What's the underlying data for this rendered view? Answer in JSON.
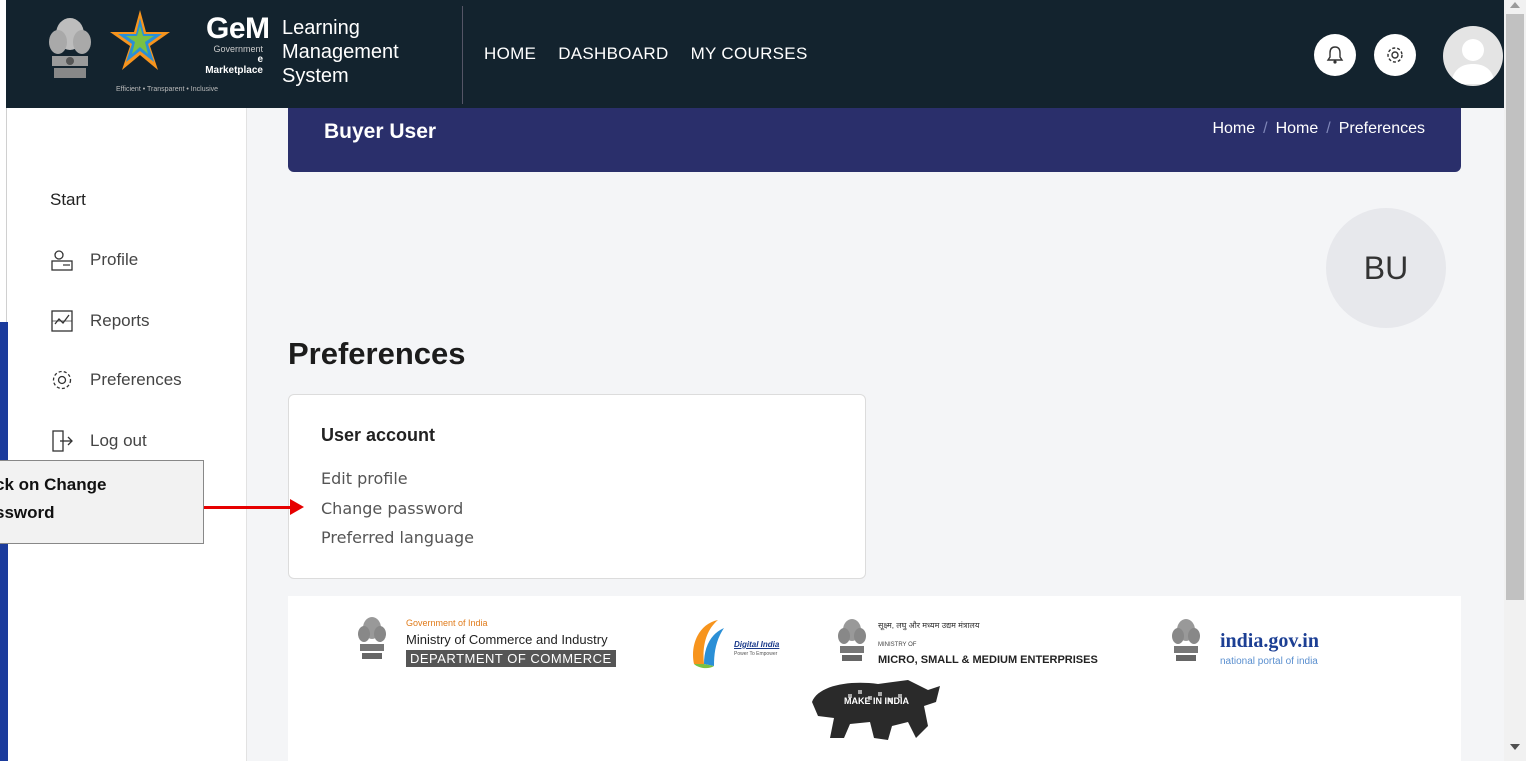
{
  "brand": {
    "gem_word": "GeM",
    "gem_sub1": "Government",
    "gem_sub2": "e Marketplace",
    "gem_tagline": "Efficient • Transparent • Inclusive",
    "lms_title": "Learning Management System"
  },
  "nav": {
    "links": [
      "HOME",
      "DASHBOARD",
      "MY COURSES"
    ]
  },
  "header": {
    "title": "Buyer User",
    "breadcrumb": [
      "Home",
      "Home",
      "Preferences"
    ]
  },
  "sidebar": {
    "heading": "Start",
    "items": [
      {
        "label": "Profile",
        "icon": "profile-icon"
      },
      {
        "label": "Reports",
        "icon": "reports-icon"
      },
      {
        "label": "Preferences",
        "icon": "gear-icon"
      },
      {
        "label": "Log out",
        "icon": "logout-icon"
      }
    ]
  },
  "user": {
    "initials": "BU"
  },
  "main": {
    "page_title": "Preferences",
    "card": {
      "title": "User account",
      "links": [
        "Edit profile",
        "Change password",
        "Preferred language"
      ]
    }
  },
  "callout": {
    "text": "ck on Change\nssword"
  },
  "footer": {
    "commerce": {
      "line1": "Government of India",
      "line2": "Ministry of Commerce and Industry",
      "line3": "DEPARTMENT OF COMMERCE"
    },
    "digital_india": {
      "name": "Digital India",
      "tagline": "Power To Empower"
    },
    "msme": {
      "hindi": "सूक्ष्म, लघु और मध्यम उद्यम मंत्रालय",
      "line1": "MINISTRY OF",
      "line2": "MICRO, SMALL & MEDIUM ENTERPRISES"
    },
    "india_gov": {
      "name": "india.gov.in",
      "tagline": "national portal of india"
    },
    "make_in_india": "MAKE IN INDIA"
  },
  "colors": {
    "navbar": "#13232e",
    "header": "#2a2f6b",
    "arrow": "#e60000"
  }
}
